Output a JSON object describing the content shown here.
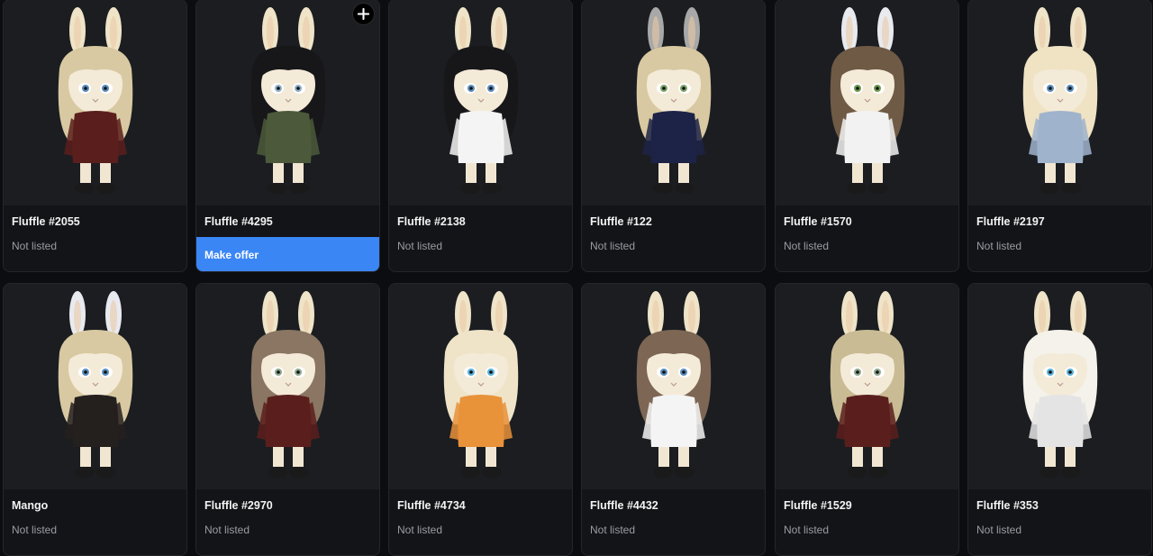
{
  "cards": [
    {
      "name": "Fluffle #2055",
      "status": "Not listed",
      "hair": "#d8c9a2",
      "outfit": "#5a1f1c",
      "ears": "#efe4c8",
      "eyes": "#5b8dbd"
    },
    {
      "name": "Fluffle #4295",
      "status": "",
      "action": "Make offer",
      "hair": "#17171a",
      "outfit": "#4c5a3b",
      "ears": "#efe4c8",
      "eyes": "#8fb0c6"
    },
    {
      "name": "Fluffle #2138",
      "status": "Not listed",
      "hair": "#17171a",
      "outfit": "#f4f4f4",
      "ears": "#efe4c8",
      "eyes": "#5b8dbd"
    },
    {
      "name": "Fluffle #122",
      "status": "Not listed",
      "hair": "#d8c9a2",
      "outfit": "#1d2347",
      "ears": "#a8a8a8",
      "eyes": "#7fa56b"
    },
    {
      "name": "Fluffle #1570",
      "status": "Not listed",
      "hair": "#6f5a45",
      "outfit": "#f2f2f2",
      "ears": "#e8eaf0",
      "eyes": "#6c9a4e"
    },
    {
      "name": "Fluffle #2197",
      "status": "Not listed",
      "hair": "#efe3c4",
      "outfit": "#9fb3cc",
      "ears": "#efe4c8",
      "eyes": "#5b8dbd"
    },
    {
      "name": "Mango",
      "status": "Not listed",
      "hair": "#d8c9a2",
      "outfit": "#24201e",
      "ears": "#e8eaf0",
      "eyes": "#5b8dbd"
    },
    {
      "name": "Fluffle #2970",
      "status": "Not listed",
      "hair": "#8a7662",
      "outfit": "#5a1f1c",
      "ears": "#efe4c8",
      "eyes": "#8fa88f"
    },
    {
      "name": "Fluffle #4734",
      "status": "Not listed",
      "hair": "#efe4c8",
      "outfit": "#e8923a",
      "ears": "#efe4c8",
      "eyes": "#5bb3d8"
    },
    {
      "name": "Fluffle #4432",
      "status": "Not listed",
      "hair": "#7d6654",
      "outfit": "#f4f4f4",
      "ears": "#efe4c8",
      "eyes": "#5b8dbd"
    },
    {
      "name": "Fluffle #1529",
      "status": "Not listed",
      "hair": "#c9bb94",
      "outfit": "#5a1f1c",
      "ears": "#efe4c8",
      "eyes": "#8fa88f"
    },
    {
      "name": "Fluffle #353",
      "status": "Not listed",
      "hair": "#f4f2ea",
      "outfit": "#e4e4e4",
      "ears": "#efe4c8",
      "eyes": "#5bb3d8"
    }
  ],
  "add_icon": "plus-icon"
}
